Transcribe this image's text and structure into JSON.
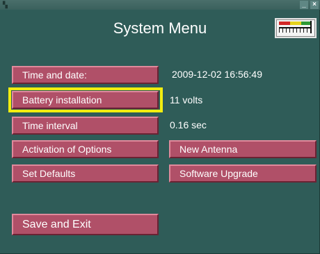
{
  "window": {
    "titlebar_icon": "app-icon",
    "minimize_label": "_",
    "close_label": "×"
  },
  "header": {
    "title": "System Menu",
    "meter_icon": "signal-meter-icon",
    "meter_colors": [
      "#d22727",
      "#e5d21c",
      "#2e9a35"
    ]
  },
  "menu": {
    "time_date": {
      "label": "Time and date:",
      "value": "2009-12-02  16:56:49"
    },
    "battery": {
      "label": "Battery installation",
      "value": "11 volts",
      "selected": true
    },
    "time_interval": {
      "label": "Time interval",
      "value": "0.16 sec"
    },
    "activation": {
      "label": "Activation of Options"
    },
    "new_antenna": {
      "label": "New Antenna"
    },
    "set_defaults": {
      "label": "Set Defaults"
    },
    "software_upgrade": {
      "label": "Software Upgrade"
    },
    "save_exit": {
      "label": "Save and Exit"
    }
  },
  "colors": {
    "background": "#2f5c58",
    "button": "#b05068",
    "highlight": "#f2ee10"
  }
}
